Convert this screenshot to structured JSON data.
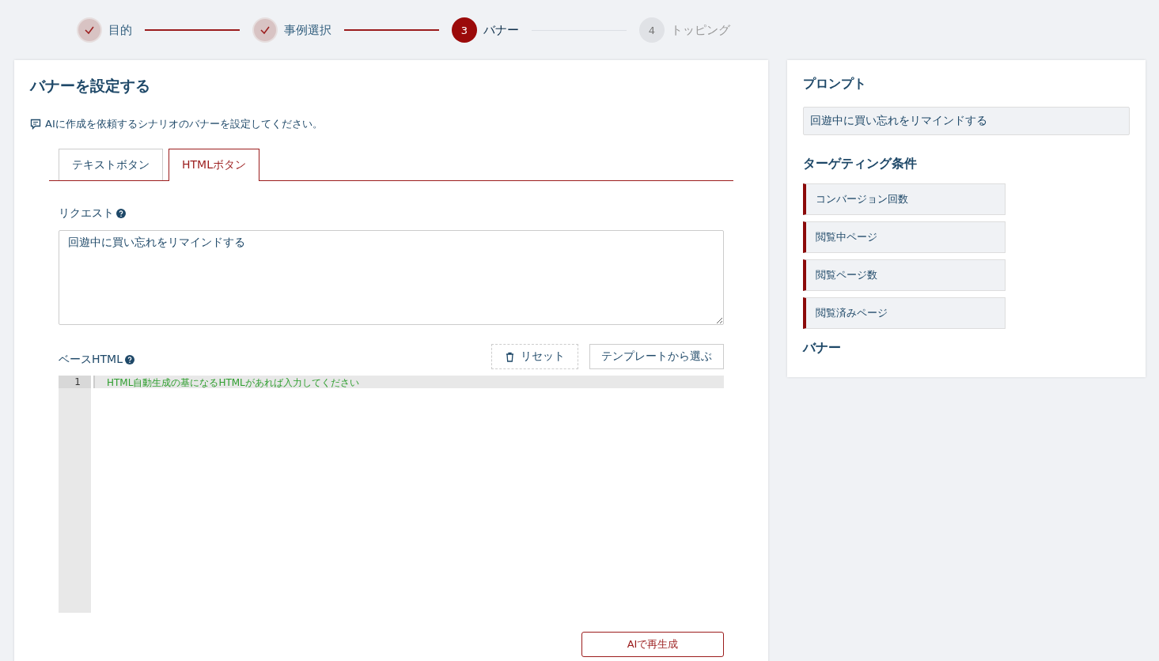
{
  "steps": [
    {
      "label": "目的",
      "completed": true,
      "selected": false
    },
    {
      "label": "事例選択",
      "completed": true,
      "selected": false
    },
    {
      "number": "3",
      "label": "バナー",
      "completed": false,
      "selected": true
    },
    {
      "number": "4",
      "label": "トッピング",
      "completed": false,
      "selected": false
    }
  ],
  "main": {
    "title": "バナーを設定する",
    "description": "AIに作成を依頼するシナリオのバナーを設定してください。",
    "tabs": [
      {
        "label": "テキストボタン",
        "selected": false
      },
      {
        "label": "HTMLボタン",
        "selected": true
      }
    ],
    "request": {
      "label": "リクエスト",
      "value": "回遊中に買い忘れをリマインドする"
    },
    "base_html": {
      "label": "ベースHTML",
      "reset_button": "リセット",
      "template_button": "テンプレートから選ぶ",
      "editor": {
        "line_numbers": [
          "1"
        ],
        "placeholder": "HTML自動生成の基になるHTMLがあれば入力してください"
      }
    },
    "regenerate_button": "AIで再生成"
  },
  "sidebar": {
    "prompt_title": "プロンプト",
    "prompt": "回遊中に買い忘れをリマインドする",
    "targeting_title": "ターゲティング条件",
    "conditions": [
      "コンバージョン回数",
      "閲覧中ページ",
      "閲覧ページ数",
      "閲覧済みページ"
    ],
    "banner_title": "バナー"
  }
}
